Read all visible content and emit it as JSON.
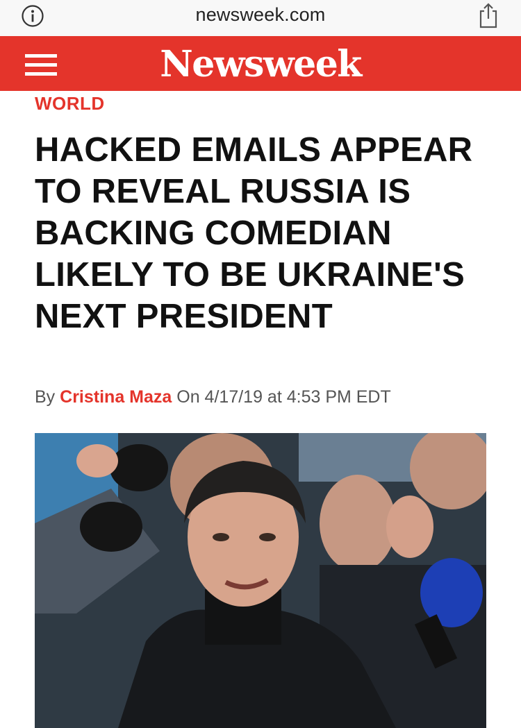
{
  "browser": {
    "url": "newsweek.com",
    "info_icon": "info-circle-icon",
    "share_icon": "share-icon"
  },
  "header": {
    "menu_icon": "hamburger-menu-icon",
    "logo_text": "Newsweek",
    "brand_color": "#e4342b"
  },
  "article": {
    "section": "WORLD",
    "headline": "HACKED EMAILS APPEAR TO REVEAL RUSSIA IS BACKING COMEDIAN LIKELY TO BE UKRAINE'S NEXT PRESIDENT",
    "byline_prefix": "By",
    "author": "Cristina Maza",
    "date_text": "On 4/17/19 at 4:53 PM EDT"
  }
}
